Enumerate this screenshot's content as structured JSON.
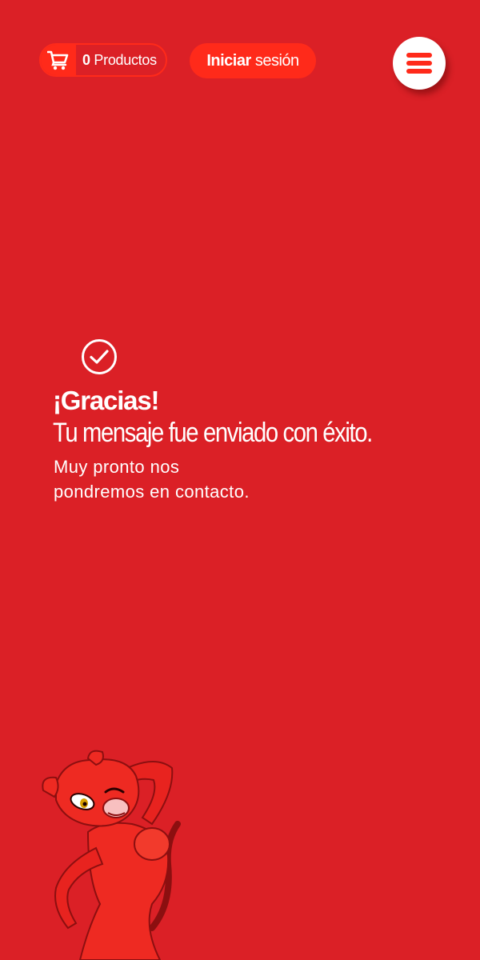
{
  "header": {
    "cart": {
      "count": "0",
      "label": "Productos",
      "icon": "cart-icon"
    },
    "login": {
      "bold": "Iniciar",
      "rest": "sesión"
    },
    "menu": {
      "icon": "hamburger-menu-icon"
    }
  },
  "confirmation": {
    "icon": "check-circle-icon",
    "title": "¡Gracias!",
    "subtitle": "Tu mensaje fue enviado con éxito.",
    "note_line1": "Muy pronto nos",
    "note_line2": "pondremos en contacto."
  },
  "colors": {
    "background": "#db2026",
    "accent": "#ff2a1a",
    "text": "#ffffff"
  }
}
